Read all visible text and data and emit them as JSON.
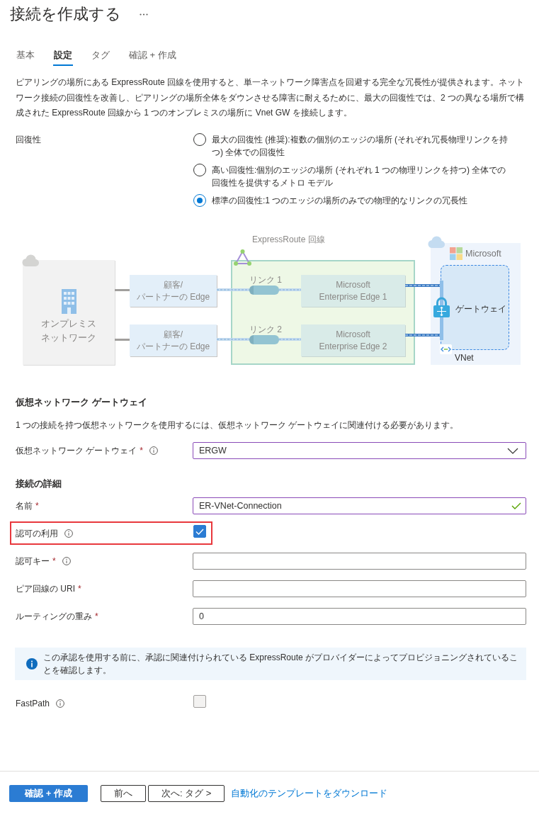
{
  "header": {
    "title": "接続を作成する"
  },
  "tabs": [
    {
      "label": "基本",
      "selected": false
    },
    {
      "label": "設定",
      "selected": true
    },
    {
      "label": "タグ",
      "selected": false
    },
    {
      "label": "確認 + 作成",
      "selected": false
    }
  ],
  "intro": "ピアリングの場所にある ExpressRoute 回線を使用すると、単一ネットワーク障害点を回避する完全な冗長性が提供されます。ネットワーク接続の回復性を改善し、ピアリングの場所全体をダウンさせる障害に耐えるために、最大の回復性では、2 つの異なる場所で構成された ExpressRoute 回線から 1 つのオンプレミスの場所に Vnet GW を接続します。",
  "resiliency": {
    "label": "回復性",
    "options": [
      {
        "label": "最大の回復性 (推奨):複数の個別のエッジの場所 (それぞれ冗長物理リンクを持つ) 全体での回復性",
        "selected": false
      },
      {
        "label": "高い回復性:個別のエッジの場所 (それぞれ 1 つの物理リンクを持つ) 全体での回復性を提供するメトロ モデル",
        "selected": false
      },
      {
        "label": "標準の回復性:1 つのエッジの場所のみでの物理的なリンクの冗長性",
        "selected": true
      }
    ]
  },
  "diagram": {
    "on_premises": "オンプレミスネットワーク",
    "circuit": "ExpressRoute 回線",
    "links": [
      {
        "customer_edge": "顧客/\nパートナーの Edge",
        "link": "リンク 1",
        "enterprise_edge": "Microsoft\nEnterprise Edge 1"
      },
      {
        "customer_edge": "顧客/\nパートナーの Edge",
        "link": "リンク 2",
        "enterprise_edge": "Microsoft\nEnterprise Edge 2"
      }
    ],
    "cloud": "Microsoft",
    "gateway": "ゲートウェイ",
    "vnet": "VNet"
  },
  "gateway_section": {
    "heading": "仮想ネットワーク ゲートウェイ",
    "description": "1 つの接続を持つ仮想ネットワークを使用するには、仮想ネットワーク ゲートウェイに関連付ける必要があります。",
    "fields": [
      {
        "kind": "select",
        "label": "仮想ネットワーク ゲートウェイ",
        "required_mark": "*",
        "info": true,
        "value": "ERGW",
        "edited": true,
        "highlighted": false
      }
    ]
  },
  "details": {
    "heading": "接続の詳細",
    "fields": [
      {
        "kind": "text",
        "label": "名前",
        "required_mark": "*",
        "info": false,
        "value": "ER-VNet-Connection",
        "edited": true,
        "valid": true,
        "highlighted": false
      },
      {
        "kind": "checkbox",
        "label": "認可の利用",
        "info": true,
        "checked": true,
        "highlighted": true
      },
      {
        "kind": "text",
        "label": "認可キー",
        "required_mark": "*",
        "info": true,
        "edited": false,
        "valid": false,
        "highlighted": false
      },
      {
        "kind": "text",
        "label": "ピア回線の URI",
        "required_mark": "*",
        "info": false,
        "edited": false,
        "valid": false,
        "highlighted": false
      },
      {
        "kind": "text",
        "label": "ルーティングの重み",
        "required_mark": "*",
        "info": false,
        "value": "0",
        "edited": false,
        "valid": false,
        "highlighted": false
      },
      {
        "kind": "notice",
        "text": "この承認を使用する前に、承認に関連付けられている ExpressRoute がプロバイダーによってプロビジョニングされていることを確認します。"
      },
      {
        "kind": "checkbox",
        "label": "FastPath",
        "info": true,
        "checked": false,
        "highlighted": false
      }
    ]
  },
  "footer": {
    "buttons": [
      {
        "kind": "primary",
        "label": "確認 + 作成"
      },
      {
        "kind": "secondary",
        "label": "前へ"
      },
      {
        "kind": "secondary",
        "label": "次へ: タグ >"
      },
      {
        "kind": "link",
        "label": "自動化のテンプレートをダウンロード"
      }
    ]
  }
}
